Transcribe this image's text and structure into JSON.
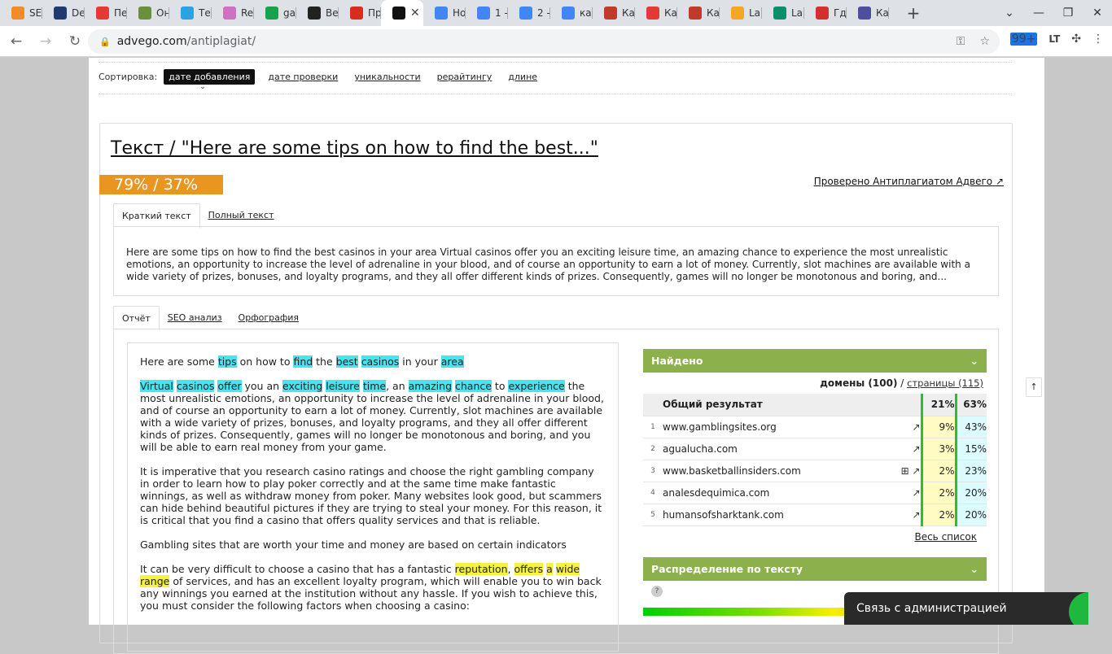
{
  "browser": {
    "tabs": [
      {
        "label": "SE",
        "icon": "orange-b-icon",
        "color": "#f28c28"
      },
      {
        "label": "De",
        "icon": "hexagon-icon",
        "color": "#1f3a6e"
      },
      {
        "label": "Пе",
        "icon": "red-bug-icon",
        "color": "#e53935"
      },
      {
        "label": "Он",
        "icon": "code-icon",
        "color": "#6b8f3a"
      },
      {
        "label": "Те",
        "icon": "telegram-icon",
        "color": "#2aa3e0"
      },
      {
        "label": "Re",
        "icon": "ring-icon",
        "color": "#d070c0"
      },
      {
        "label": "ga",
        "icon": "sheets-icon",
        "color": "#16a34a"
      },
      {
        "label": "Ве",
        "icon": "film-icon",
        "color": "#222222"
      },
      {
        "label": "Пр",
        "icon": "c-circle-icon",
        "color": "#d62d20"
      },
      {
        "label": "",
        "icon": "advego-icon",
        "color": "#111111",
        "active": true
      },
      {
        "label": "Но",
        "icon": "docs-icon",
        "color": "#4285f4"
      },
      {
        "label": "1 -",
        "icon": "docs-icon",
        "color": "#4285f4"
      },
      {
        "label": "2 -",
        "icon": "docs-icon",
        "color": "#4285f4"
      },
      {
        "label": "ка",
        "icon": "google-icon",
        "color": "#4285f4"
      },
      {
        "label": "Ка",
        "icon": "bird-icon",
        "color": "#c0392b"
      },
      {
        "label": "Ка",
        "icon": "casino-icon",
        "color": "#e53935"
      },
      {
        "label": "Ка",
        "icon": "rocket-icon",
        "color": "#c0392b"
      },
      {
        "label": "La",
        "icon": "sg-icon",
        "color": "#f5a623"
      },
      {
        "label": "La",
        "icon": "lq-icon",
        "color": "#0b8f6b"
      },
      {
        "label": "Гд",
        "icon": "opera-icon",
        "color": "#d32f2f"
      },
      {
        "label": "Ка",
        "icon": "orb-icon",
        "color": "#4b4f9c"
      }
    ],
    "new_tab": "+",
    "url_domain": "advego.com",
    "url_path": "/antiplagiat/",
    "ext_badge": "99+",
    "ext_lt": "LT"
  },
  "sort": {
    "label": "Сортировка:",
    "active": "дате добавления",
    "options": [
      "дате проверки",
      "уникальности",
      "рерайтингу",
      "длине"
    ]
  },
  "card": {
    "title": "Текст / \"Here are some tips on how to find the best...\"",
    "score": "79% / 37%",
    "checked_by": "Проверено Антиплагиатом Адвего",
    "tabs_top": [
      "Краткий текст",
      "Полный текст"
    ],
    "preview": "Here are some tips on how to find the best casinos in your area Virtual casinos offer you an exciting leisure time, an amazing chance to experience the most unrealistic emotions, an opportunity to increase the level of adrenaline in your blood, and of course an opportunity to earn a lot of money. Currently, slot machines are available with a wide variety of prizes, bonuses, and loyalty programs, and they all offer different kinds of prizes. Consequently, games will no longer be monotonous and boring, and...",
    "tabs_report": [
      "Отчёт",
      "SEO анализ",
      "Орфография"
    ]
  },
  "report": {
    "p1": [
      {
        "t": "Here are some "
      },
      {
        "t": "tips",
        "h": "c"
      },
      {
        "t": " on how to "
      },
      {
        "t": "find",
        "h": "c"
      },
      {
        "t": " the "
      },
      {
        "t": "best",
        "h": "c"
      },
      {
        "t": " "
      },
      {
        "t": "casinos",
        "h": "c"
      },
      {
        "t": " in your "
      },
      {
        "t": "area",
        "h": "c"
      }
    ],
    "p2": [
      {
        "t": "Virtual",
        "h": "c"
      },
      {
        "t": " "
      },
      {
        "t": "casinos",
        "h": "c"
      },
      {
        "t": " "
      },
      {
        "t": "offer",
        "h": "c"
      },
      {
        "t": " you an "
      },
      {
        "t": "exciting",
        "h": "c"
      },
      {
        "t": " "
      },
      {
        "t": "leisure",
        "h": "c"
      },
      {
        "t": " "
      },
      {
        "t": "time",
        "h": "c"
      },
      {
        "t": ", an "
      },
      {
        "t": "amazing",
        "h": "c"
      },
      {
        "t": " "
      },
      {
        "t": "chance",
        "h": "c"
      },
      {
        "t": " to "
      },
      {
        "t": "experience",
        "h": "c"
      },
      {
        "t": " the most unrealistic emotions, an opportunity to increase the level of adrenaline in your blood, and of course an opportunity to earn a lot of money. Currently, slot machines are available with a wide variety of prizes, bonuses, and loyalty programs, and they all offer different kinds of prizes. Consequently, games will no longer be monotonous and boring, and you will be able to earn real money from your game."
      }
    ],
    "p3": "It is imperative that you research casino ratings and choose the right gambling company in order to learn how to play poker correctly and at the same time make fantastic winnings, as well as withdraw money from poker. Many websites look good, but scammers can hide behind beautiful pictures if they are trying to steal your money. For this reason, it is critical that you find a casino that offers quality services and that is reliable.",
    "p4": "Gambling sites that are worth your time and money are based on certain indicators",
    "p5": [
      {
        "t": "It can be very difficult to choose a casino that has a fantastic "
      },
      {
        "t": "reputation",
        "h": "y"
      },
      {
        "t": ", "
      },
      {
        "t": "offers",
        "h": "y"
      },
      {
        "t": " "
      },
      {
        "t": "a",
        "h": "y"
      },
      {
        "t": " "
      },
      {
        "t": "wide",
        "h": "y"
      },
      {
        "t": " "
      },
      {
        "t": "range",
        "h": "y"
      },
      {
        "t": " of services, and has an excellent loyalty program, which will enable you to win back any winnings you earned at the institution without any hassle. If you wish to achieve this, you must consider the following factors when choosing a casino:"
      }
    ]
  },
  "found": {
    "title": "Найдено",
    "domains": "домены (100)",
    "separator": "/",
    "pages": "страницы (115)",
    "total_label": "Общий результат",
    "total_p1": "21%",
    "total_p2": "63%",
    "rows": [
      {
        "n": "1",
        "site": "www.gamblingsites.org",
        "p1": "9%",
        "p2": "43%"
      },
      {
        "n": "2",
        "site": "agualucha.com",
        "p1": "3%",
        "p2": "15%"
      },
      {
        "n": "3",
        "site": "www.basketballinsiders.com",
        "p1": "2%",
        "p2": "23%",
        "plus": true
      },
      {
        "n": "4",
        "site": "analesdequimica.com",
        "p1": "2%",
        "p2": "20%"
      },
      {
        "n": "5",
        "site": "humansofsharktank.com",
        "p1": "2%",
        "p2": "20%"
      }
    ],
    "full_list": "Весь список"
  },
  "distribution": {
    "title": "Распределение по тексту",
    "help": "?"
  },
  "admin": {
    "label": "Связь с администрацией"
  },
  "scroll_up": "↑"
}
